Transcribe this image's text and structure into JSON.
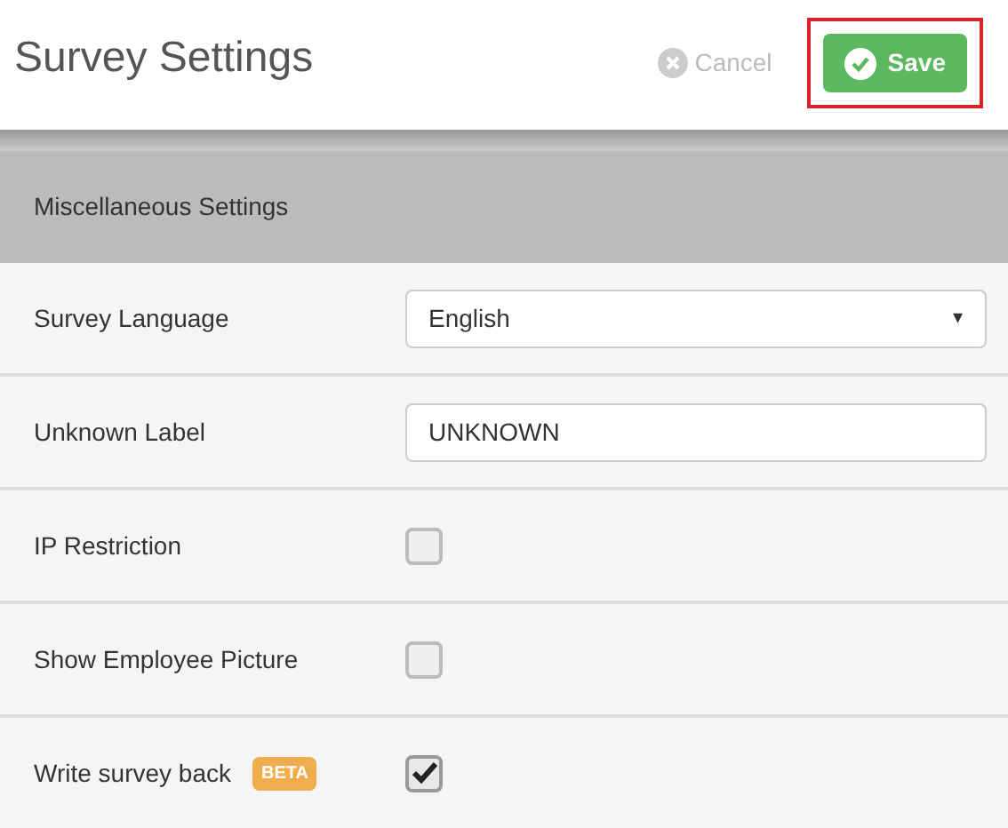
{
  "header": {
    "title": "Survey Settings",
    "cancel": "Cancel",
    "save": "Save"
  },
  "section": {
    "title": "Miscellaneous Settings"
  },
  "rows": [
    {
      "kind": "select",
      "label": "Survey Language",
      "value": "English",
      "caret": "▾"
    },
    {
      "kind": "text",
      "label": "Unknown Label",
      "value": "UNKNOWN"
    },
    {
      "kind": "checkbox",
      "label": "IP Restriction",
      "checked": false
    },
    {
      "kind": "checkbox",
      "label": "Show Employee Picture",
      "checked": false
    },
    {
      "kind": "checkbox",
      "label": "Write survey back",
      "badge": "BETA",
      "checked": true
    }
  ]
}
